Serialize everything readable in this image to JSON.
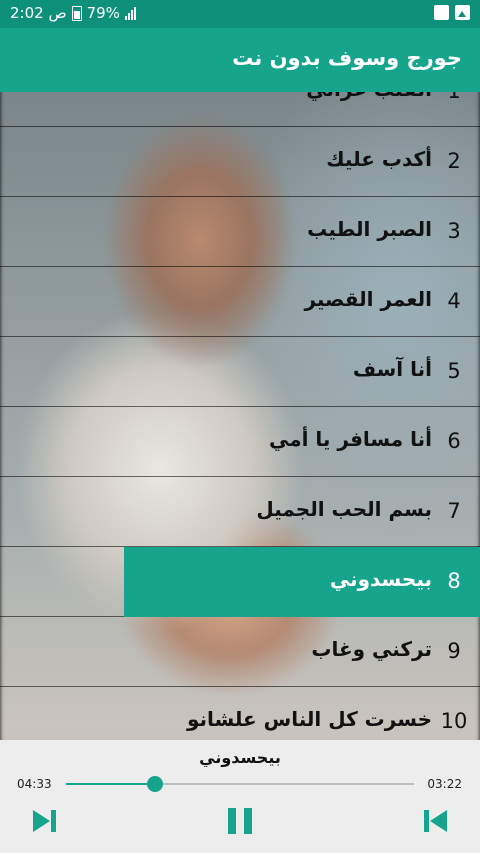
{
  "status_bar": {
    "time": "2:02 ص",
    "battery": "79%",
    "icons": [
      "gallery-icon",
      "sim-icon",
      "battery-icon",
      "signal-icon"
    ]
  },
  "app_bar": {
    "title": "جورج وسوف بدون نت"
  },
  "tracks": [
    {
      "num": "1",
      "name": "القلب عزاني"
    },
    {
      "num": "2",
      "name": "أكدب عليك"
    },
    {
      "num": "3",
      "name": "الصبر الطيب"
    },
    {
      "num": "4",
      "name": "العمر القصير"
    },
    {
      "num": "5",
      "name": "أنا آسف"
    },
    {
      "num": "6",
      "name": "أنا مسافر يا أمي"
    },
    {
      "num": "7",
      "name": "بسم الحب الجميل"
    },
    {
      "num": "8",
      "name": "بيحسدوني"
    },
    {
      "num": "9",
      "name": "تركني وغاب"
    },
    {
      "num": "10",
      "name": "خسرت كل الناس علشانو"
    }
  ],
  "active_track_index": 7,
  "player": {
    "now_playing": "بيحسدوني",
    "time_left": "04:33",
    "time_right": "03:22",
    "progress": 0.255,
    "accent_color": "#16a58c"
  }
}
